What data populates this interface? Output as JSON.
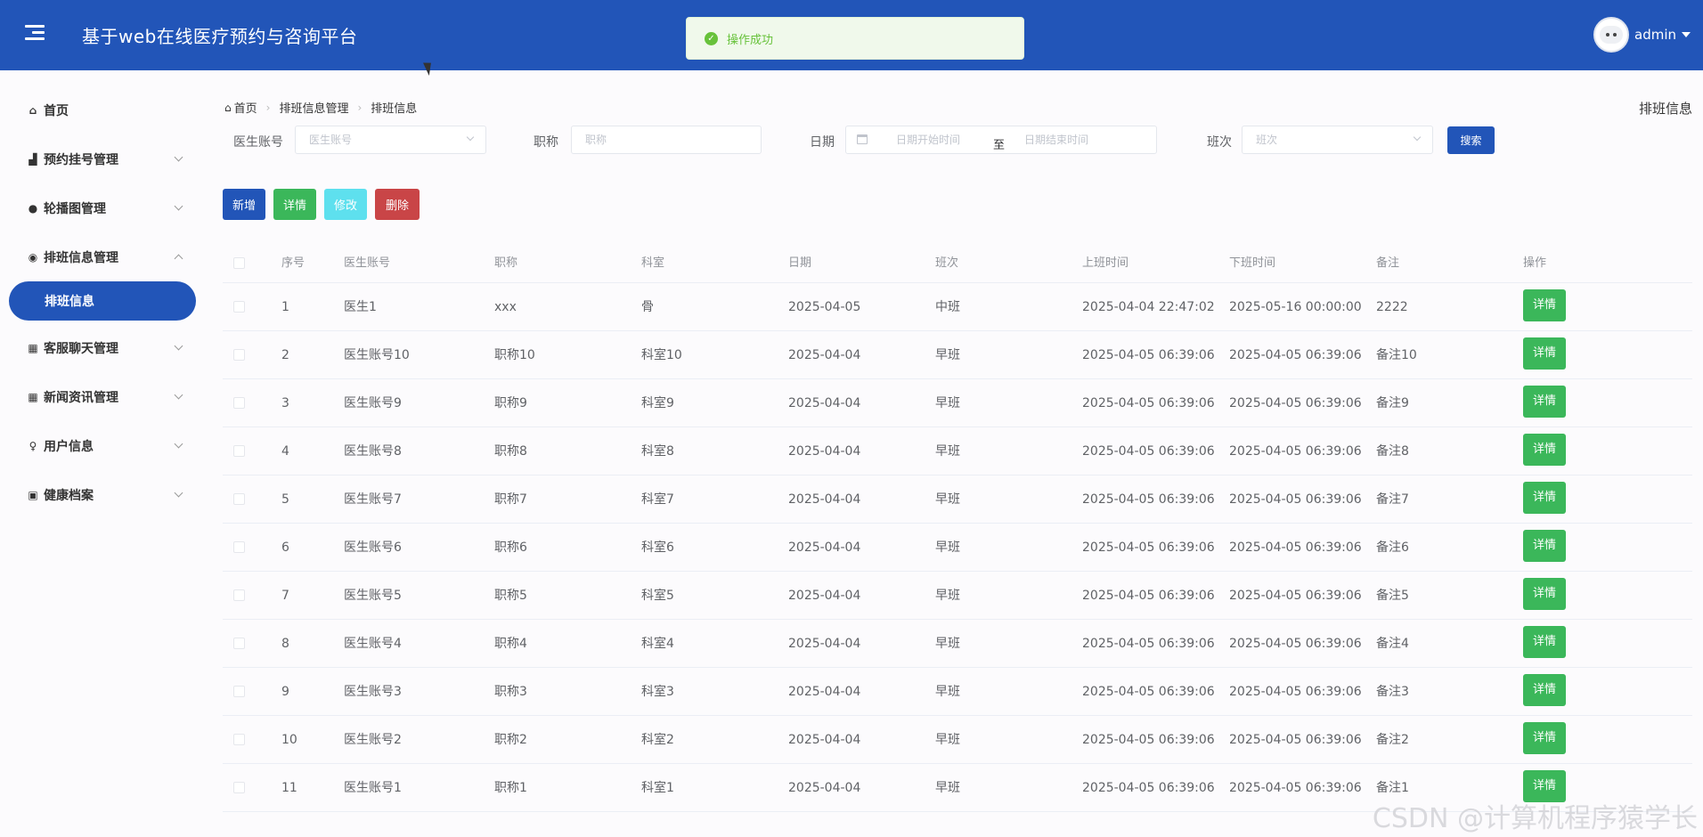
{
  "header": {
    "title": "基于web在线医疗预约与咨询平台",
    "toast": "操作成功",
    "user": "admin"
  },
  "sidebar": {
    "items": [
      {
        "label": "首页",
        "icon": "home-icon"
      },
      {
        "label": "预约挂号管理",
        "icon": "building-icon"
      },
      {
        "label": "轮播图管理",
        "icon": "drop-icon"
      },
      {
        "label": "排班信息管理",
        "icon": "circle-icon"
      },
      {
        "label": "客服聊天管理",
        "icon": "grid-icon"
      },
      {
        "label": "新闻资讯管理",
        "icon": "grid-icon"
      },
      {
        "label": "用户信息",
        "icon": "user-icon"
      },
      {
        "label": "健康档案",
        "icon": "briefcase-icon"
      }
    ],
    "active_sub": "排班信息"
  },
  "breadcrumb": [
    "首页",
    "排班信息管理",
    "排班信息"
  ],
  "page_title": "排班信息",
  "search": {
    "doctor_label": "医生账号",
    "doctor_placeholder": "医生账号",
    "title_label": "职称",
    "title_placeholder": "职称",
    "date_label": "日期",
    "date_start_placeholder": "日期开始时间",
    "date_sep": "至",
    "date_end_placeholder": "日期结束时间",
    "shift_label": "班次",
    "shift_placeholder": "班次",
    "search_button": "搜索"
  },
  "actions": {
    "add": "新增",
    "detail": "详情",
    "edit": "修改",
    "delete": "删除"
  },
  "table": {
    "columns": [
      "序号",
      "医生账号",
      "职称",
      "科室",
      "日期",
      "班次",
      "上班时间",
      "下班时间",
      "备注",
      "操作"
    ],
    "row_button": "详情",
    "rows": [
      [
        "1",
        "医生1",
        "xxx",
        "骨",
        "2025-04-05",
        "中班",
        "2025-04-04 22:47:02",
        "2025-05-16 00:00:00",
        "2222"
      ],
      [
        "2",
        "医生账号10",
        "职称10",
        "科室10",
        "2025-04-04",
        "早班",
        "2025-04-05 06:39:06",
        "2025-04-05 06:39:06",
        "备注10"
      ],
      [
        "3",
        "医生账号9",
        "职称9",
        "科室9",
        "2025-04-04",
        "早班",
        "2025-04-05 06:39:06",
        "2025-04-05 06:39:06",
        "备注9"
      ],
      [
        "4",
        "医生账号8",
        "职称8",
        "科室8",
        "2025-04-04",
        "早班",
        "2025-04-05 06:39:06",
        "2025-04-05 06:39:06",
        "备注8"
      ],
      [
        "5",
        "医生账号7",
        "职称7",
        "科室7",
        "2025-04-04",
        "早班",
        "2025-04-05 06:39:06",
        "2025-04-05 06:39:06",
        "备注7"
      ],
      [
        "6",
        "医生账号6",
        "职称6",
        "科室6",
        "2025-04-04",
        "早班",
        "2025-04-05 06:39:06",
        "2025-04-05 06:39:06",
        "备注6"
      ],
      [
        "7",
        "医生账号5",
        "职称5",
        "科室5",
        "2025-04-04",
        "早班",
        "2025-04-05 06:39:06",
        "2025-04-05 06:39:06",
        "备注5"
      ],
      [
        "8",
        "医生账号4",
        "职称4",
        "科室4",
        "2025-04-04",
        "早班",
        "2025-04-05 06:39:06",
        "2025-04-05 06:39:06",
        "备注4"
      ],
      [
        "9",
        "医生账号3",
        "职称3",
        "科室3",
        "2025-04-04",
        "早班",
        "2025-04-05 06:39:06",
        "2025-04-05 06:39:06",
        "备注3"
      ],
      [
        "10",
        "医生账号2",
        "职称2",
        "科室2",
        "2025-04-04",
        "早班",
        "2025-04-05 06:39:06",
        "2025-04-05 06:39:06",
        "备注2"
      ],
      [
        "11",
        "医生账号1",
        "职称1",
        "科室1",
        "2025-04-04",
        "早班",
        "2025-04-05 06:39:06",
        "2025-04-05 06:39:06",
        "备注1"
      ]
    ]
  },
  "watermark": "CSDN @计算机程序猿学长"
}
